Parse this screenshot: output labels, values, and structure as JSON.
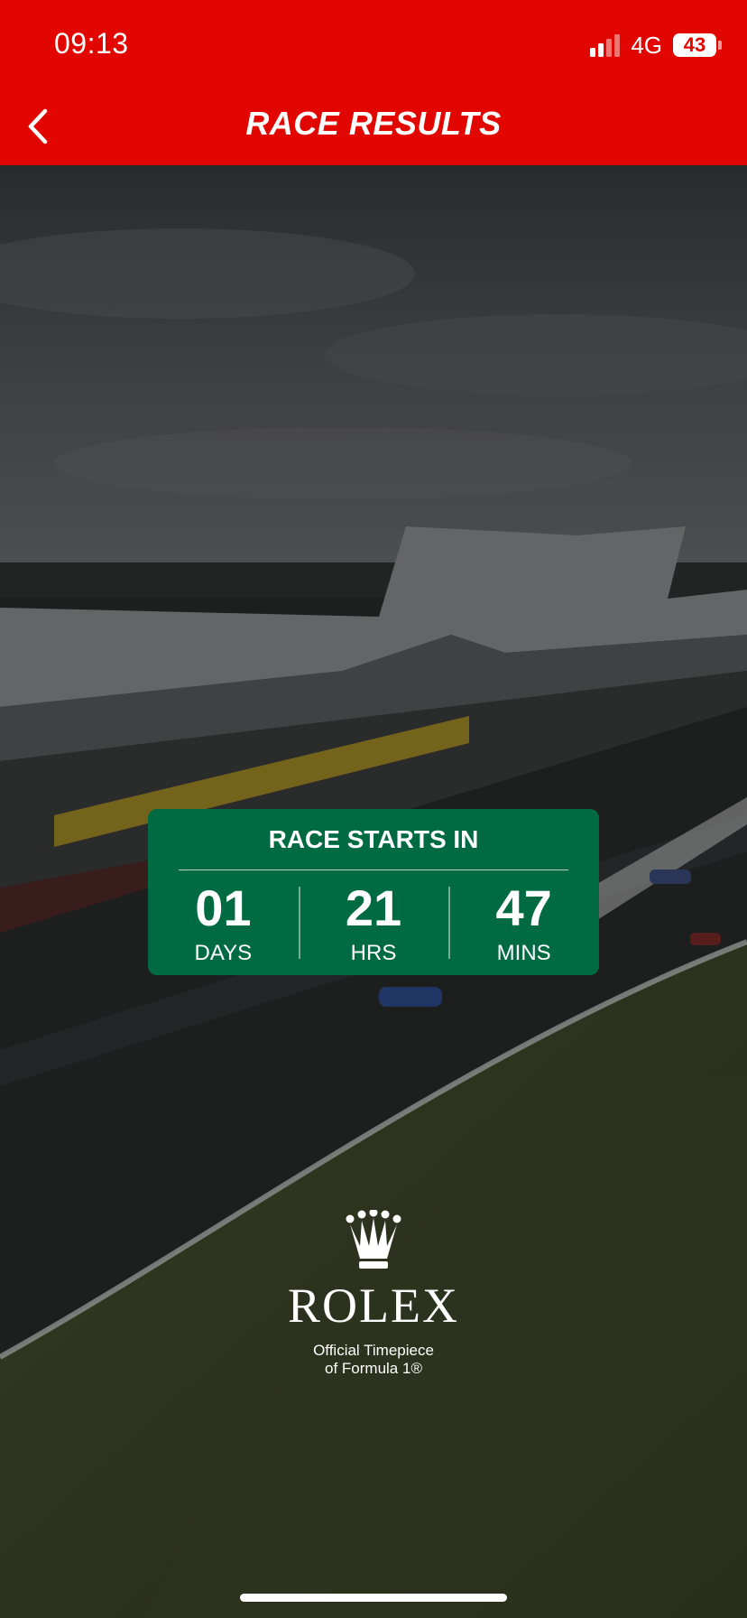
{
  "status_bar": {
    "time": "09:13",
    "network": "4G",
    "battery": "43"
  },
  "nav": {
    "title": "RACE RESULTS",
    "back_icon": "chevron-left-icon"
  },
  "countdown": {
    "title": "RACE STARTS IN",
    "units": [
      {
        "value": "01",
        "label": "DAYS"
      },
      {
        "value": "21",
        "label": "HRS"
      },
      {
        "value": "47",
        "label": "MINS"
      }
    ]
  },
  "sponsor": {
    "brand": "ROLEX",
    "tagline_line1": "Official Timepiece",
    "tagline_line2": "of Formula 1®",
    "logo_icon": "crown-icon"
  },
  "colors": {
    "header": "#e10600",
    "countdown_bg": "#006a43",
    "text": "#ffffff"
  }
}
